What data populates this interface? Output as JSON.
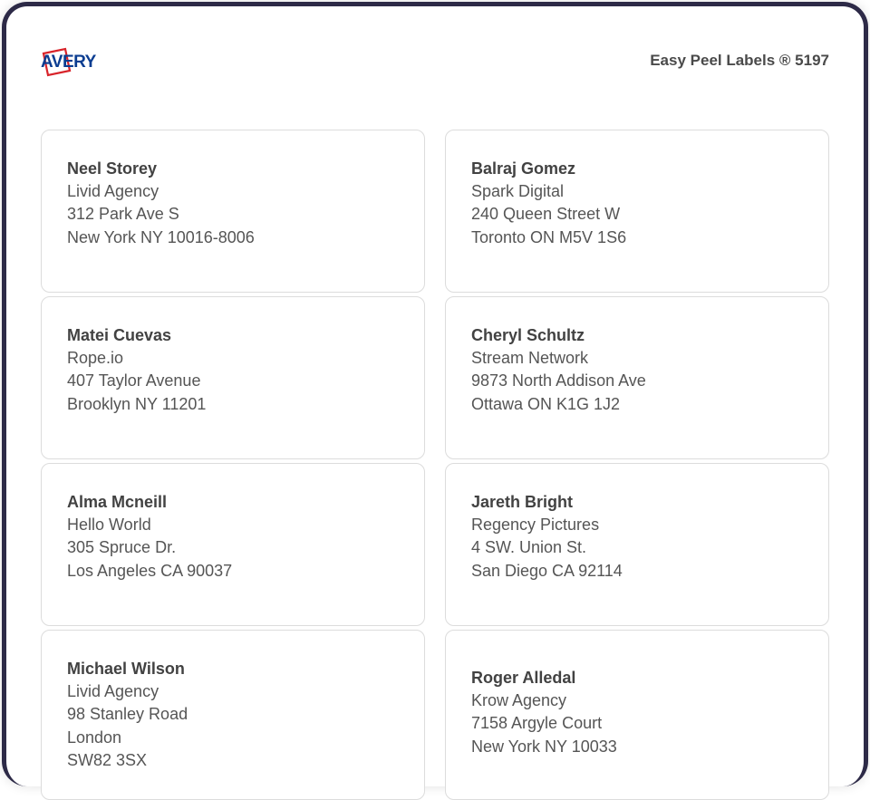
{
  "header": {
    "logo_text": "AVERY",
    "product": "Easy Peel Labels ® 5197"
  },
  "labels": [
    {
      "name": "Neel Storey",
      "company": "Livid Agency",
      "street": "312 Park Ave S",
      "city": "New York NY 10016-8006",
      "extra": ""
    },
    {
      "name": "Balraj Gomez",
      "company": "Spark Digital",
      "street": "240 Queen Street W",
      "city": "Toronto ON M5V 1S6",
      "extra": ""
    },
    {
      "name": "Matei Cuevas",
      "company": "Rope.io",
      "street": "407 Taylor Avenue",
      "city": "Brooklyn NY 11201",
      "extra": ""
    },
    {
      "name": "Cheryl Schultz",
      "company": "Stream Network",
      "street": "9873 North Addison Ave",
      "city": "Ottawa ON K1G 1J2",
      "extra": ""
    },
    {
      "name": "Alma Mcneill",
      "company": "Hello World",
      "street": "305 Spruce Dr.",
      "city": "Los Angeles CA 90037",
      "extra": ""
    },
    {
      "name": "Jareth Bright",
      "company": "Regency Pictures",
      "street": "4 SW. Union St.",
      "city": "San Diego CA 92114",
      "extra": ""
    },
    {
      "name": "Michael Wilson",
      "company": "Livid Agency",
      "street": "98 Stanley Road",
      "city": "London",
      "extra": "SW82 3SX"
    },
    {
      "name": "Roger Alledal",
      "company": "Krow Agency",
      "street": "7158 Argyle Court",
      "city": "New York NY 10033",
      "extra": ""
    }
  ]
}
